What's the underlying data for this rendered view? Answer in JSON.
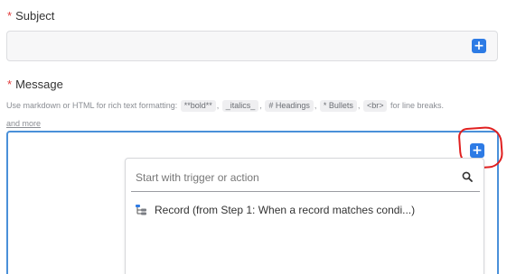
{
  "subject": {
    "required_mark": "*",
    "label": "Subject",
    "value": "",
    "add_button_icon": "plus-icon"
  },
  "message": {
    "required_mark": "*",
    "label": "Message",
    "help": {
      "prefix": "Use markdown or HTML for rich text formatting:",
      "codes": [
        "**bold**",
        "_italics_",
        "# Headings",
        "* Bullets",
        "<br>"
      ],
      "suffix": "for line breaks.",
      "more_link": "and more"
    },
    "value": "",
    "add_button_icon": "plus-icon"
  },
  "picker": {
    "search_placeholder": "Start with trigger or action",
    "items": [
      {
        "label": "Record (from Step 1: When a record matches condi...)",
        "icon": "record-tree-icon"
      }
    ]
  },
  "colors": {
    "accent": "#2d7be5",
    "required": "#e23b3b",
    "focus_border": "#4a90d9",
    "annotation": "#e02020"
  }
}
